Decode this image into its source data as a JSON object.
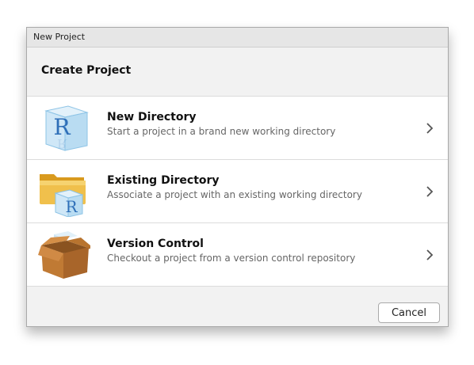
{
  "window": {
    "title": "New Project"
  },
  "header": {
    "title": "Create Project"
  },
  "options": [
    {
      "title": "New Directory",
      "description": "Start a project in a brand new working directory",
      "icon": "r-cube-icon"
    },
    {
      "title": "Existing Directory",
      "description": "Associate a project with an existing working directory",
      "icon": "folder-r-cube-icon"
    },
    {
      "title": "Version Control",
      "description": "Checkout a project from a version control repository",
      "icon": "open-box-icon"
    }
  ],
  "footer": {
    "cancel_label": "Cancel"
  },
  "icon_glyphs": {
    "r_letter": "R"
  },
  "colors": {
    "r_blue": "#2f6fb8",
    "folder": "#e9b33c",
    "box": "#b8742f"
  }
}
